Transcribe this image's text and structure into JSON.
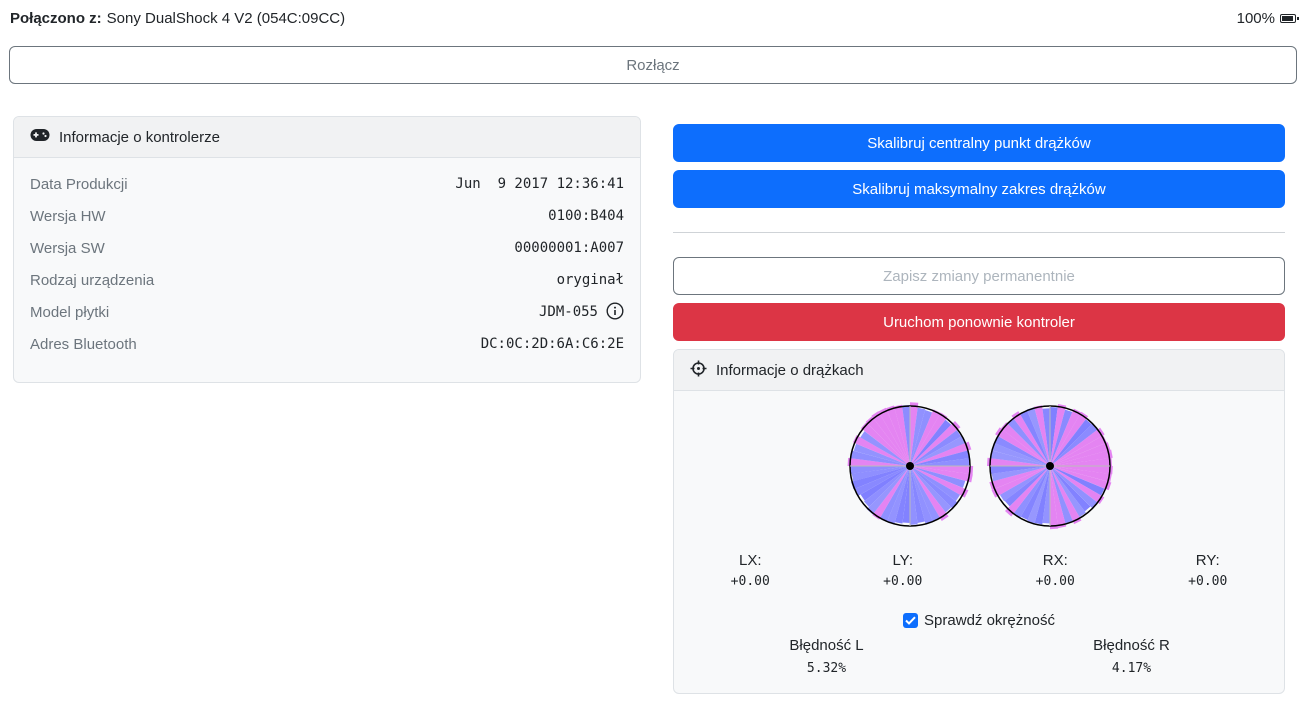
{
  "header": {
    "connected_label": "Połączono z:",
    "device_name": "Sony DualShock 4 V2 (054C:09CC)",
    "battery_text": "100%",
    "battery_level": 1.0,
    "battery_icon": "battery-full-icon"
  },
  "disconnect_label": "Rozłącz",
  "controller_info": {
    "title": "Informacje o kontrolerze",
    "icon": "gamepad-icon",
    "rows": [
      {
        "label": "Data Produkcji",
        "value": "Jun  9 2017 12:36:41"
      },
      {
        "label": "Wersja HW",
        "value": "0100:B404"
      },
      {
        "label": "Wersja SW",
        "value": "00000001:A007"
      },
      {
        "label": "Rodzaj urządzenia",
        "value": "oryginał"
      },
      {
        "label": "Model płytki",
        "value": "JDM-055"
      },
      {
        "label": "Adres Bluetooth",
        "value": "DC:0C:2D:6A:C6:2E"
      }
    ]
  },
  "actions": {
    "calibrate_center": "Skalibruj centralny punkt drążków",
    "calibrate_range": "Skalibruj maksymalny zakres drążków",
    "save_permanent": "Zapisz zmiany permanentnie",
    "restart": "Uruchom ponownie kontroler"
  },
  "stick_info": {
    "title": "Informacje o drążkach",
    "icon": "crosshair-icon",
    "axes": [
      {
        "name": "LX:",
        "value": "+0.00"
      },
      {
        "name": "LY:",
        "value": "+0.00"
      },
      {
        "name": "RX:",
        "value": "+0.00"
      },
      {
        "name": "RY:",
        "value": "+0.00"
      }
    ],
    "circularity_label": "Sprawdź okrężność",
    "circularity_checked": true,
    "error_left_label": "Błędność L",
    "error_left_value": "5.32%",
    "error_right_label": "Błędność R",
    "error_right_value": "4.17%"
  },
  "colors": {
    "primary": "#0d6efd",
    "danger": "#dc3545",
    "stick_fill": "#8080ff",
    "stick_error": "#e070f0"
  }
}
